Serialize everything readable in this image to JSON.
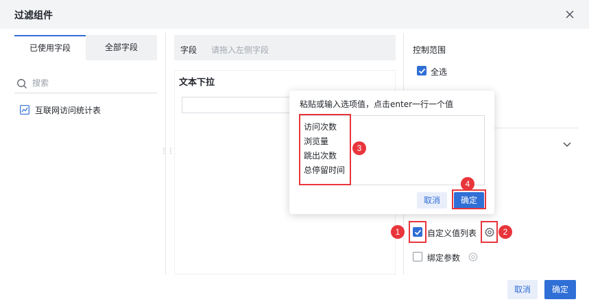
{
  "dialog": {
    "title": "过滤组件"
  },
  "left_panel": {
    "tabs": [
      {
        "label": "已使用字段",
        "active": true
      },
      {
        "label": "全部字段",
        "active": false
      }
    ],
    "search": {
      "placeholder": "搜索",
      "value": ""
    },
    "fields": [
      {
        "label": "互联网访问统计表",
        "icon": "line-chart-icon"
      }
    ]
  },
  "middle_panel": {
    "field_label": "字段",
    "field_drop_placeholder": "请拖入左侧字段",
    "preview_title": "文本下拉"
  },
  "right_panel": {
    "control_range_title": "控制范围",
    "select_all_label": "全选",
    "select_all_checked": true,
    "custom_value_list_label": "自定义值列表",
    "custom_value_list_checked": true,
    "bind_param_label": "绑定参数",
    "bind_param_checked": false
  },
  "popover": {
    "hint": "粘贴或输入选项值，点击enter一行一个值",
    "values": [
      "访问次数",
      "浏览量",
      "跳出次数",
      "总停留时间"
    ],
    "cancel_label": "取消",
    "ok_label": "确定"
  },
  "footer": {
    "cancel_label": "取消",
    "ok_label": "确定"
  },
  "annotations": {
    "markers": [
      "1",
      "2",
      "3",
      "4"
    ]
  },
  "colors": {
    "primary": "#2f6fd6",
    "annotation_red": "#e8353b",
    "header_bg": "#f3f4f6"
  }
}
